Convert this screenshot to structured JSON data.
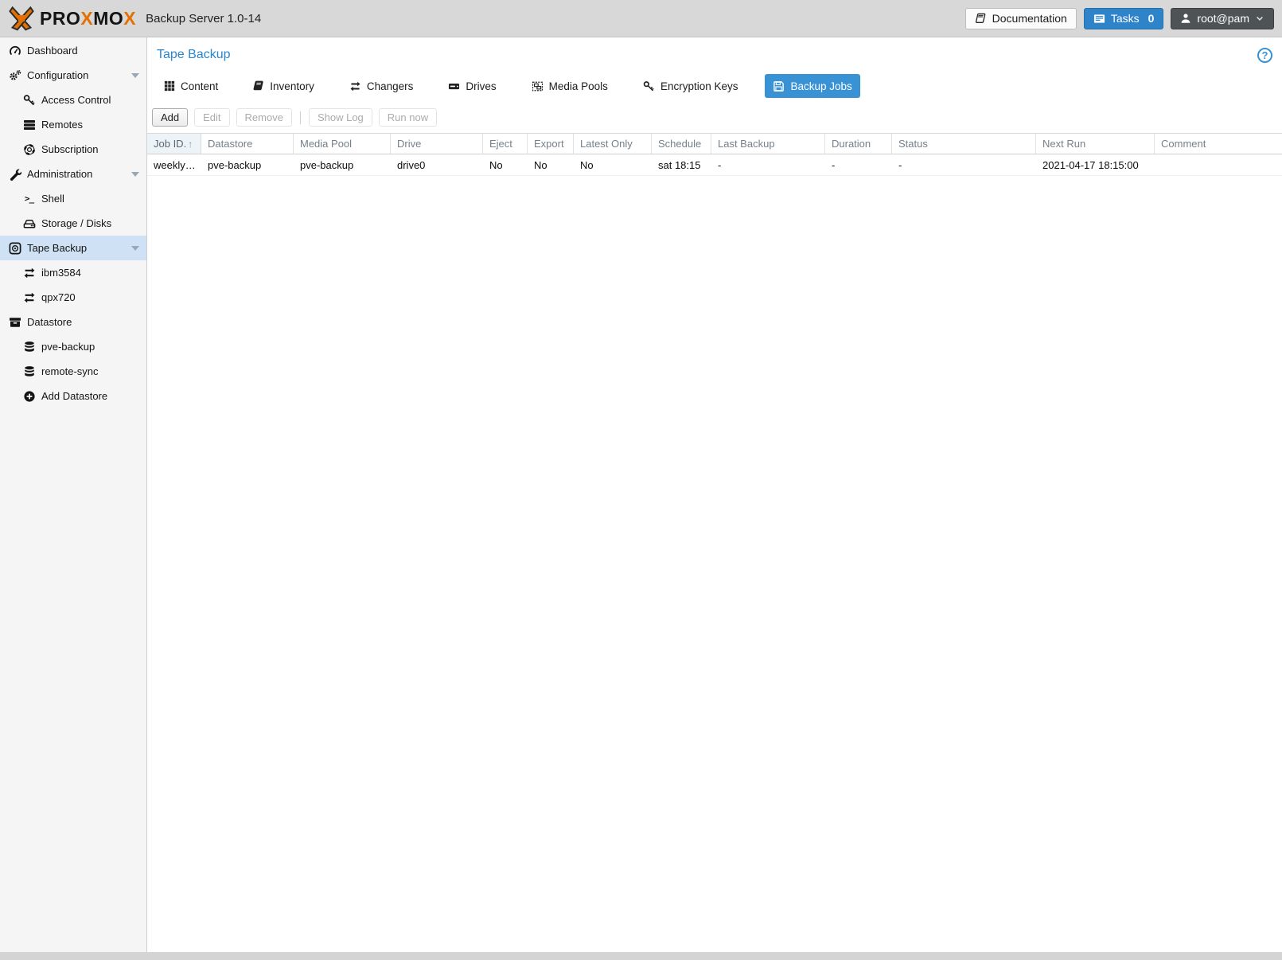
{
  "header": {
    "brand_p1": "PRO",
    "brand_x1": "X",
    "brand_p2": "MO",
    "brand_x2": "X",
    "subtitle": "Backup Server 1.0-14",
    "documentation_label": "Documentation",
    "tasks_label": "Tasks",
    "tasks_count": "0",
    "user_label": "root@pam"
  },
  "icons": {
    "shell_glyph": ">_",
    "help_glyph": "?",
    "sort_arrow": "↑"
  },
  "colors": {
    "accent": "#3892d4",
    "brand_orange": "#e57000",
    "selection": "#cfe2f5",
    "topbar": "#d8d8d8",
    "sidebar": "#f5f5f5"
  },
  "sidebar": {
    "items": [
      {
        "label": "Dashboard"
      },
      {
        "label": "Configuration",
        "expanded": true
      },
      {
        "label": "Access Control"
      },
      {
        "label": "Remotes"
      },
      {
        "label": "Subscription"
      },
      {
        "label": "Administration",
        "expanded": true
      },
      {
        "label": "Shell"
      },
      {
        "label": "Storage / Disks"
      },
      {
        "label": "Tape Backup",
        "expanded": true,
        "selected": true
      },
      {
        "label": "ibm3584"
      },
      {
        "label": "qpx720"
      },
      {
        "label": "Datastore"
      },
      {
        "label": "pve-backup"
      },
      {
        "label": "remote-sync"
      },
      {
        "label": "Add Datastore"
      }
    ]
  },
  "main": {
    "title": "Tape Backup",
    "tabs": [
      {
        "label": "Content"
      },
      {
        "label": "Inventory"
      },
      {
        "label": "Changers"
      },
      {
        "label": "Drives"
      },
      {
        "label": "Media Pools"
      },
      {
        "label": "Encryption Keys"
      },
      {
        "label": "Backup Jobs",
        "active": true
      }
    ],
    "toolbar": [
      {
        "label": "Add",
        "enabled": true
      },
      {
        "label": "Edit",
        "enabled": false
      },
      {
        "label": "Remove",
        "enabled": false
      },
      {
        "label": "Show Log",
        "enabled": false
      },
      {
        "label": "Run now",
        "enabled": false
      }
    ],
    "table": {
      "columns": [
        "Job ID.",
        "Datastore",
        "Media Pool",
        "Drive",
        "Eject",
        "Export",
        "Latest Only",
        "Schedule",
        "Last Backup",
        "Duration",
        "Status",
        "Next Run",
        "Comment"
      ],
      "sorted_column": "Job ID.",
      "sort_direction": "asc",
      "rows": [
        [
          "weekly…",
          "pve-backup",
          "pve-backup",
          "drive0",
          "No",
          "No",
          "No",
          "sat 18:15",
          "-",
          "-",
          "-",
          "2021-04-17 18:15:00",
          ""
        ]
      ]
    }
  }
}
